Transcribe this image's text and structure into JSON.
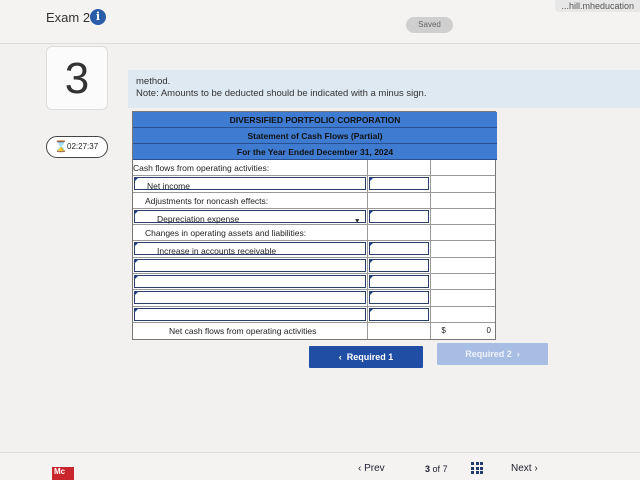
{
  "header": {
    "exam_title": "Exam 2",
    "saved_label": "Saved",
    "url_fragment": "...hill.mheducation"
  },
  "sidebar": {
    "question_number": "3",
    "timer": "02:27:37"
  },
  "instruction": {
    "line1": "method.",
    "line2": "Note: Amounts to be deducted should be indicated with a minus sign."
  },
  "statement": {
    "company": "DIVERSIFIED PORTFOLIO CORPORATION",
    "title": "Statement of Cash Flows (Partial)",
    "period": "For the Year Ended December 31, 2024",
    "rows": [
      {
        "label": "Cash flows from operating activities:"
      },
      {
        "label": "Net income"
      },
      {
        "label": "Adjustments for noncash effects:"
      },
      {
        "label": "Depreciation expense"
      },
      {
        "label": "Changes in operating assets and liabilities:"
      },
      {
        "label": "Increase in accounts receivable"
      },
      {
        "label": ""
      },
      {
        "label": ""
      },
      {
        "label": ""
      },
      {
        "label": ""
      }
    ],
    "total_label": "Net cash flows from operating activities",
    "total_currency": "$",
    "total_value": "0"
  },
  "buttons": {
    "required1": "Required 1",
    "required2": "Required 2"
  },
  "footer": {
    "logo": "Mc",
    "prev": "Prev",
    "page_current": "3",
    "page_of": "of",
    "page_total": "7",
    "next": "Next"
  }
}
